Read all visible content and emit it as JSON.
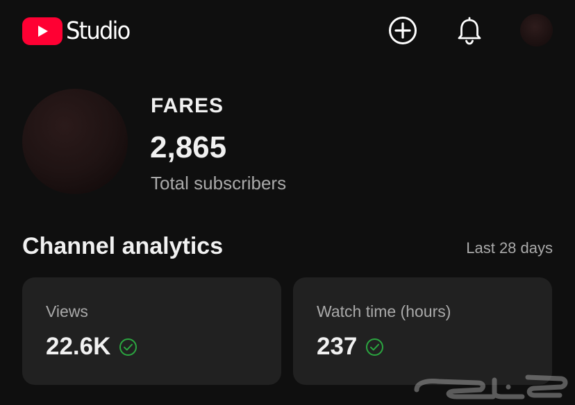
{
  "header": {
    "logo_text": "Studio",
    "icons": {
      "logo": "youtube-play-icon",
      "create": "create-plus-icon",
      "notifications": "bell-icon",
      "account": "account-avatar"
    }
  },
  "channel": {
    "name": "FARES",
    "subscribers": "2,865",
    "subscribers_label": "Total subscribers"
  },
  "analytics": {
    "title": "Channel analytics",
    "period": "Last 28 days",
    "cards": [
      {
        "label": "Views",
        "value": "22.6K",
        "status_icon": "check-circle-icon"
      },
      {
        "label": "Watch time (hours)",
        "value": "237",
        "status_icon": "check-circle-icon"
      }
    ]
  },
  "watermark": {
    "icon": "haraj-watermark"
  },
  "colors": {
    "background": "#0f0f0f",
    "card": "#212121",
    "brand_red": "#ff0033",
    "text_primary": "#f1f1f1",
    "text_secondary": "#aaaaaa",
    "success_green": "#2ba640"
  }
}
